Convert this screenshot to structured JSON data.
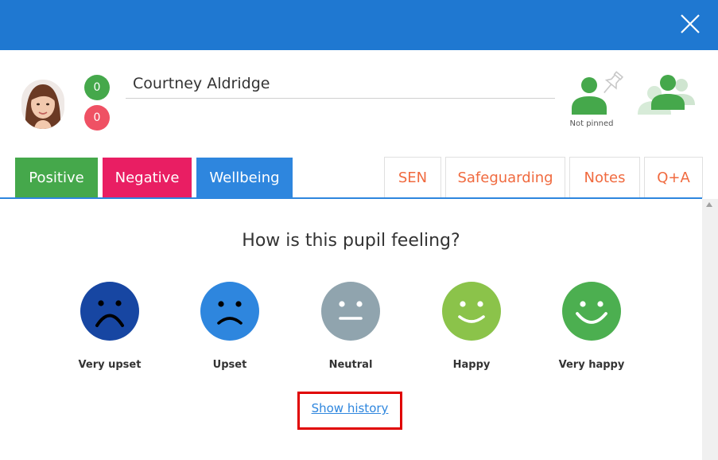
{
  "header": {
    "close_icon": "close-icon"
  },
  "pupil": {
    "name": "Courtney Aldridge",
    "positive_count": "0",
    "negative_count": "0",
    "pin_label": "Not pinned"
  },
  "tabs": [
    {
      "label": "Positive",
      "color": "#45a84b"
    },
    {
      "label": "Negative",
      "color": "#e91e63"
    },
    {
      "label": "Wellbeing",
      "color": "#2e86de"
    },
    {
      "label": "SEN"
    },
    {
      "label": "Safeguarding"
    },
    {
      "label": "Notes"
    },
    {
      "label": "Q+A"
    }
  ],
  "wellbeing": {
    "question": "How is this pupil feeling?",
    "moods": [
      {
        "label": "Very upset",
        "color": "#1746a2"
      },
      {
        "label": "Upset",
        "color": "#2e86de"
      },
      {
        "label": "Neutral",
        "color": "#90a4ae"
      },
      {
        "label": "Happy",
        "color": "#8bc34a"
      },
      {
        "label": "Very happy",
        "color": "#4caf50"
      }
    ],
    "show_history": "Show history"
  }
}
